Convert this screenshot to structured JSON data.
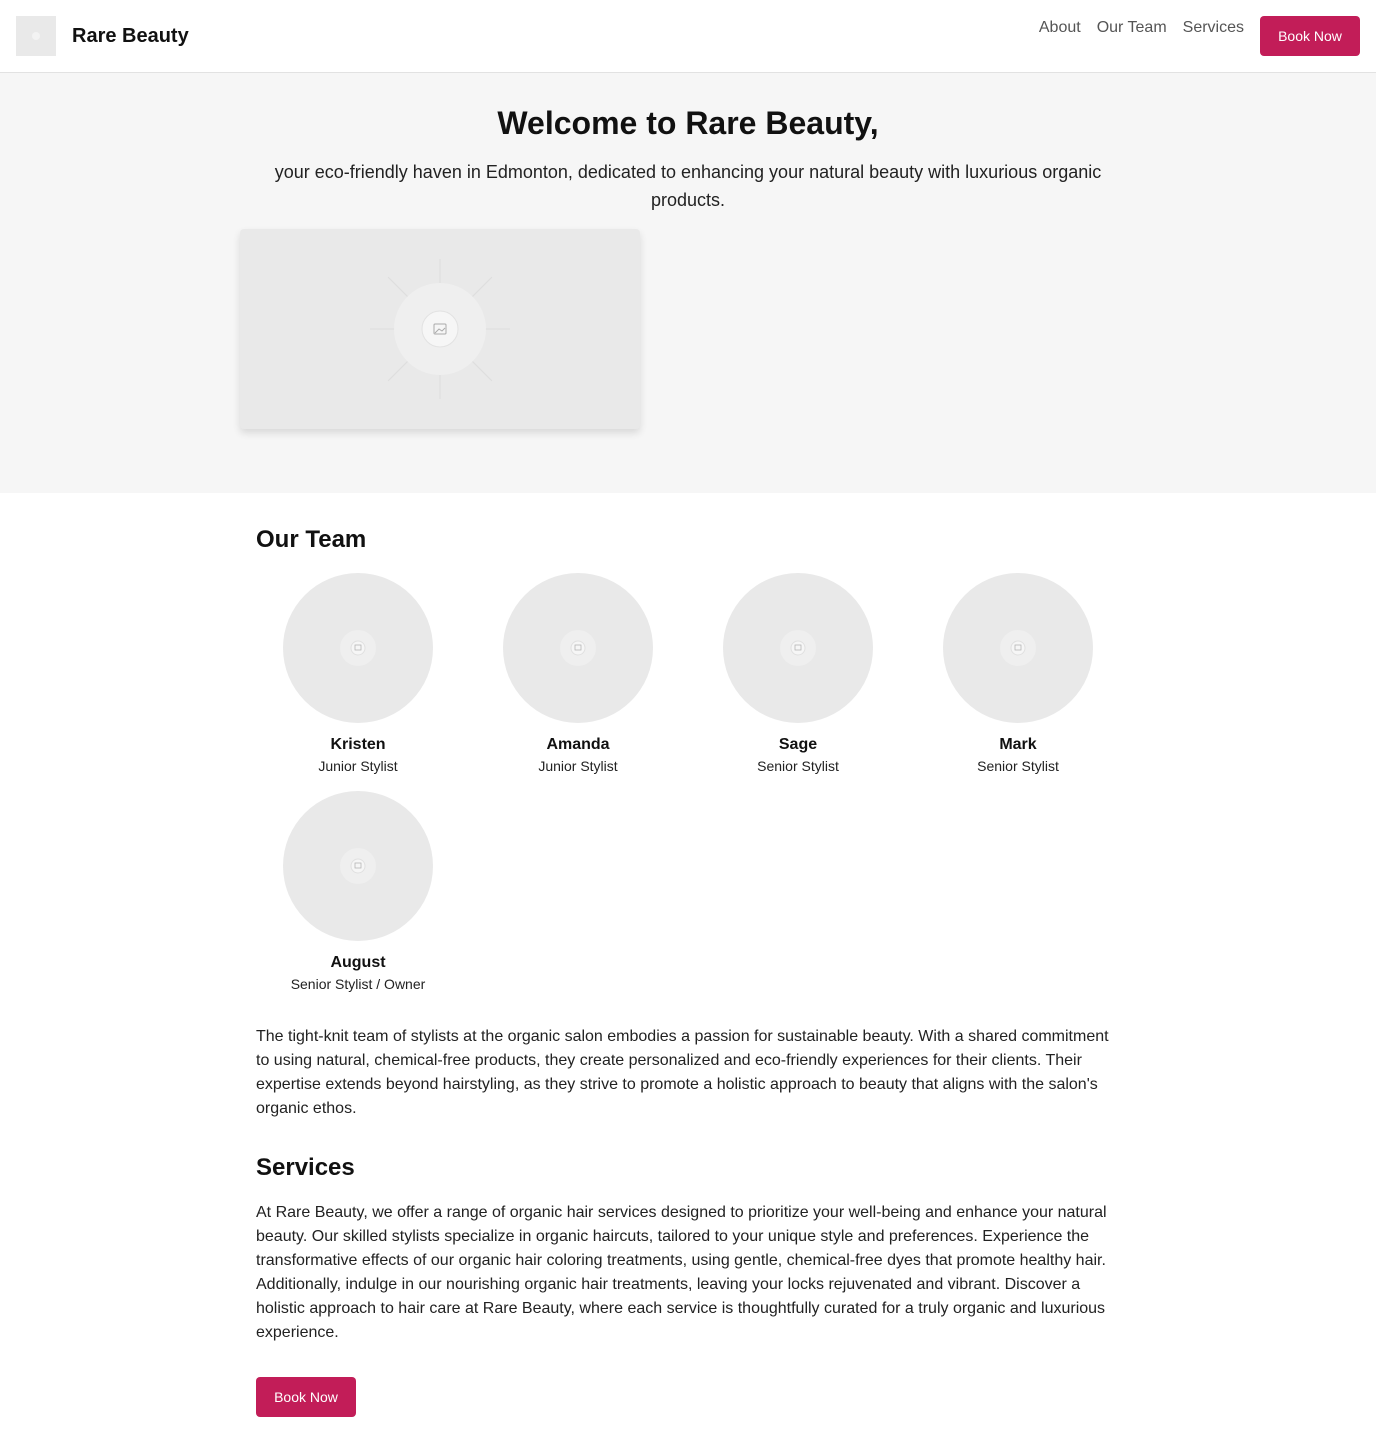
{
  "header": {
    "brand": "Rare Beauty",
    "nav": [
      "About",
      "Our Team",
      "Services"
    ],
    "cta_label": "Book Now"
  },
  "hero": {
    "title": "Welcome to Rare Beauty,",
    "subtitle": "your eco-friendly haven in Edmonton, dedicated to enhancing your natural beauty with luxurious organic products."
  },
  "team": {
    "title": "Our Team",
    "members": [
      {
        "name": "Kristen",
        "role": "Junior Stylist"
      },
      {
        "name": "Amanda",
        "role": "Junior Stylist"
      },
      {
        "name": "Sage",
        "role": "Senior Stylist"
      },
      {
        "name": "Mark",
        "role": "Senior Stylist"
      },
      {
        "name": "August",
        "role": "Senior Stylist / Owner"
      }
    ],
    "description": "The tight-knit team of stylists at the organic salon embodies a passion for sustainable beauty. With a shared commitment to using natural, chemical-free products, they create personalized and eco-friendly experiences for their clients. Their expertise extends beyond hairstyling, as they strive to promote a holistic approach to beauty that aligns with the salon's organic ethos."
  },
  "services": {
    "title": "Services",
    "description": "At Rare Beauty, we offer a range of organic hair services designed to prioritize your well-being and enhance your natural beauty. Our skilled stylists specialize in organic haircuts, tailored to your unique style and preferences. Experience the transformative effects of our organic hair coloring treatments, using gentle, chemical-free dyes that promote healthy hair. Additionally, indulge in our nourishing organic hair treatments, leaving your locks rejuvenated and vibrant. Discover a holistic approach to hair care at Rare Beauty, where each service is thoughtfully curated for a truly organic and luxurious experience.",
    "cta_label": "Book Now"
  },
  "icons": {
    "logo": "image-placeholder-icon",
    "hero_image": "image-placeholder-icon",
    "avatar": "image-placeholder-icon"
  },
  "colors": {
    "accent": "#c21d58",
    "hero_bg": "#f6f6f6",
    "placeholder": "#e9e9e9"
  }
}
